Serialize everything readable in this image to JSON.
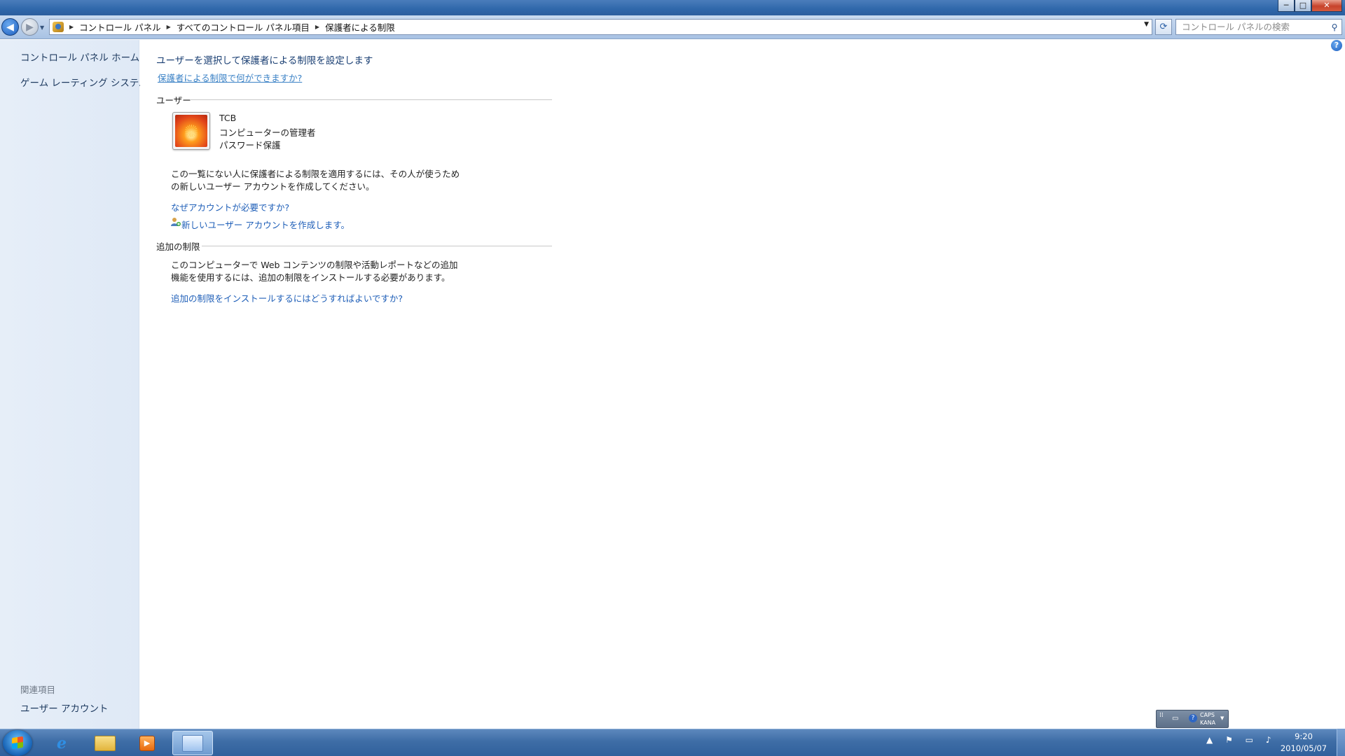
{
  "window": {
    "controls": {
      "minimize": "─",
      "maximize": "□",
      "close": "✕"
    }
  },
  "navbar": {
    "back_icon": "back-arrow-icon",
    "forward_icon": "forward-arrow-icon",
    "breadcrumbs": [
      "コントロール パネル",
      "すべてのコントロール パネル項目",
      "保護者による制限"
    ],
    "search_placeholder": "コントロール パネルの検索"
  },
  "sidebar": {
    "items": [
      {
        "label": "コントロール パネル ホーム"
      },
      {
        "label": "ゲーム レーティング システム"
      }
    ],
    "see_also_title": "関連項目",
    "see_also_items": [
      {
        "label": "ユーザー アカウント"
      }
    ]
  },
  "main": {
    "heading": "ユーザーを選択して保護者による制限を設定します",
    "help_link": "保護者による制限で何ができますか?",
    "users_section": {
      "title": "ユーザー",
      "user": {
        "name": "TCB",
        "role": "コンピューターの管理者",
        "status": "パスワード保護"
      },
      "note_line1": "この一覧にない人に保護者による制限を適用するには、その人が使うため",
      "note_line2": "の新しいユーザー アカウントを作成してください。",
      "why_link": "なぜアカウントが必要ですか?",
      "create_link": "新しいユーザー アカウントを作成します。"
    },
    "extra_section": {
      "title": "追加の制限",
      "text_line1": "このコンピューターで Web コンテンツの制限や活動レポートなどの追加",
      "text_line2": "機能を使用するには、追加の制限をインストールする必要があります。",
      "install_link": "追加の制限をインストールするにはどうすればよいですか?"
    }
  },
  "taskbar": {
    "language_bar": {
      "caps": "CAPS",
      "kana": "KANA"
    },
    "clock": {
      "time": "9:20",
      "date": "2010/05/07"
    }
  }
}
